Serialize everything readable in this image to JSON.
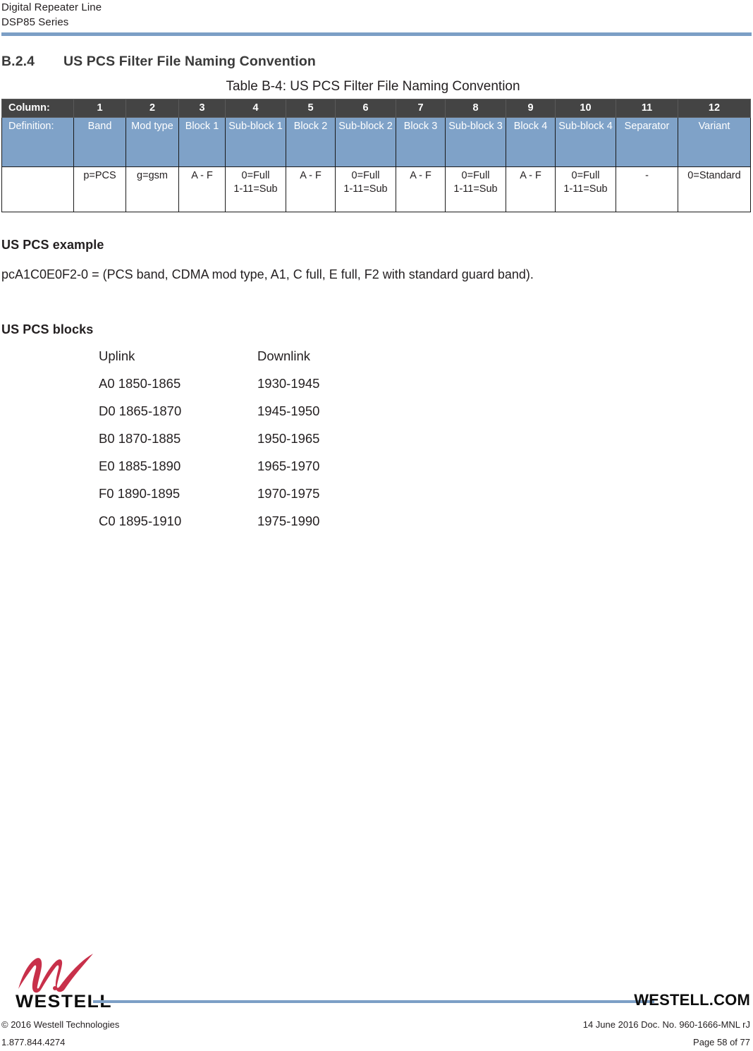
{
  "header": {
    "line1": "Digital Repeater Line",
    "line2": "DSP85 Series",
    "rule_color": "#7c9fc6"
  },
  "section": {
    "number": "B.2.4",
    "title": "US PCS Filter File Naming Convention"
  },
  "table": {
    "caption": "Table B-4: US PCS Filter File Naming Convention",
    "header_bg": "#444444",
    "definition_bg": "#7fa2c8",
    "column_label": "Column:",
    "columns": [
      "1",
      "2",
      "3",
      "4",
      "5",
      "6",
      "7",
      "8",
      "9",
      "10",
      "11",
      "12"
    ],
    "definition_label": "Definition:",
    "definitions": [
      "Band",
      "Mod type",
      "Block 1",
      "Sub-block 1",
      "Block 2",
      "Sub-block 2",
      "Block 3",
      "Sub-block 3",
      "Block 4",
      "Sub-block 4",
      "Separator",
      "Variant"
    ],
    "values_label": "",
    "values": [
      [
        "p=PCS"
      ],
      [
        "g=gsm"
      ],
      [
        "A - F"
      ],
      [
        "0=Full",
        "1-11=Sub"
      ],
      [
        "A - F"
      ],
      [
        "0=Full",
        "1-11=Sub"
      ],
      [
        "A - F"
      ],
      [
        "0=Full",
        "1-11=Sub"
      ],
      [
        "A - F"
      ],
      [
        "0=Full",
        "1-11=Sub"
      ],
      [
        "-"
      ],
      [
        "0=Standard"
      ]
    ]
  },
  "example": {
    "heading": "US PCS example",
    "text": "pcA1C0E0F2-0 = (PCS band, CDMA mod type, A1, C full, E full, F2 with standard guard band)."
  },
  "blocks": {
    "heading": "US PCS blocks",
    "col_uplink": "Uplink",
    "col_downlink": "Downlink",
    "rows": [
      {
        "uplink": "A0 1850-1865",
        "downlink": "1930-1945"
      },
      {
        "uplink": "D0 1865-1870",
        "downlink": "1945-1950"
      },
      {
        "uplink": "B0 1870-1885",
        "downlink": "1950-1965"
      },
      {
        "uplink": "E0 1885-1890",
        "downlink": "1965-1970"
      },
      {
        "uplink": "F0 1890-1895",
        "downlink": "1970-1975"
      },
      {
        "uplink": "C0 1895-1910",
        "downlink": "1975-1990"
      }
    ]
  },
  "footer": {
    "logo_wordmark": "WESTELL",
    "logo_color": "#c8304a",
    "website": "WESTELL.COM",
    "copyright": "© 2016 Westell Technologies",
    "phone": "1.877.844.4274",
    "doc_info": "14 June 2016 Doc. No. 960-1666-MNL rJ",
    "page_info": "Page 58 of 77",
    "rule_color": "#7c9fc6"
  }
}
